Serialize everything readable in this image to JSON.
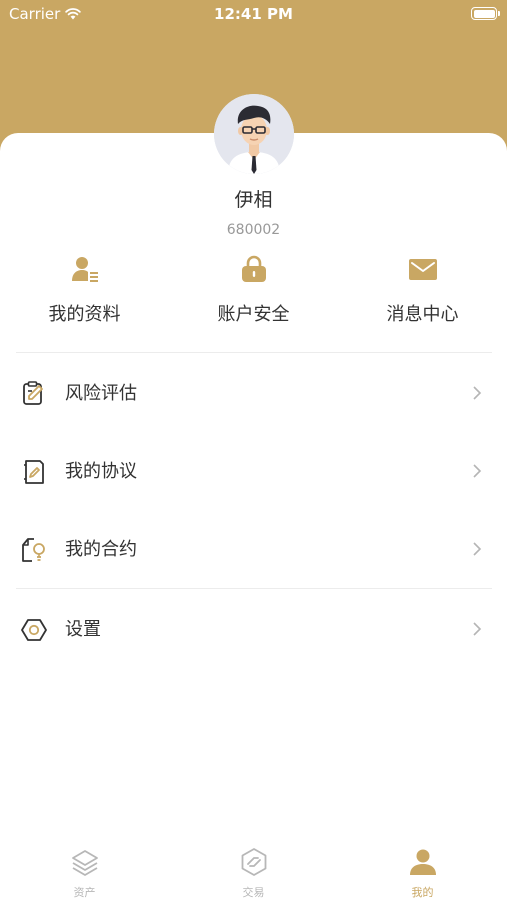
{
  "status_bar": {
    "carrier": "Carrier",
    "time": "12:41 PM"
  },
  "profile": {
    "name": "伊相",
    "id": "680002"
  },
  "quick_actions": [
    {
      "label": "我的资料",
      "icon": "profile-card-icon"
    },
    {
      "label": "账户安全",
      "icon": "lock-icon"
    },
    {
      "label": "消息中心",
      "icon": "mail-icon"
    }
  ],
  "menu": [
    {
      "label": "风险评估",
      "icon": "clipboard-edit-icon"
    },
    {
      "label": "我的协议",
      "icon": "document-edit-icon"
    },
    {
      "label": "我的合约",
      "icon": "contract-bulb-icon"
    },
    {
      "label": "设置",
      "icon": "hexagon-settings-icon"
    }
  ],
  "tabbar": [
    {
      "label": "资产",
      "icon": "layers-icon",
      "active": false
    },
    {
      "label": "交易",
      "icon": "trade-icon",
      "active": false
    },
    {
      "label": "我的",
      "icon": "user-icon",
      "active": true
    }
  ],
  "colors": {
    "accent": "#c9a763",
    "text": "#333333",
    "muted": "#999999",
    "tab_inactive": "#b7b7b7"
  }
}
